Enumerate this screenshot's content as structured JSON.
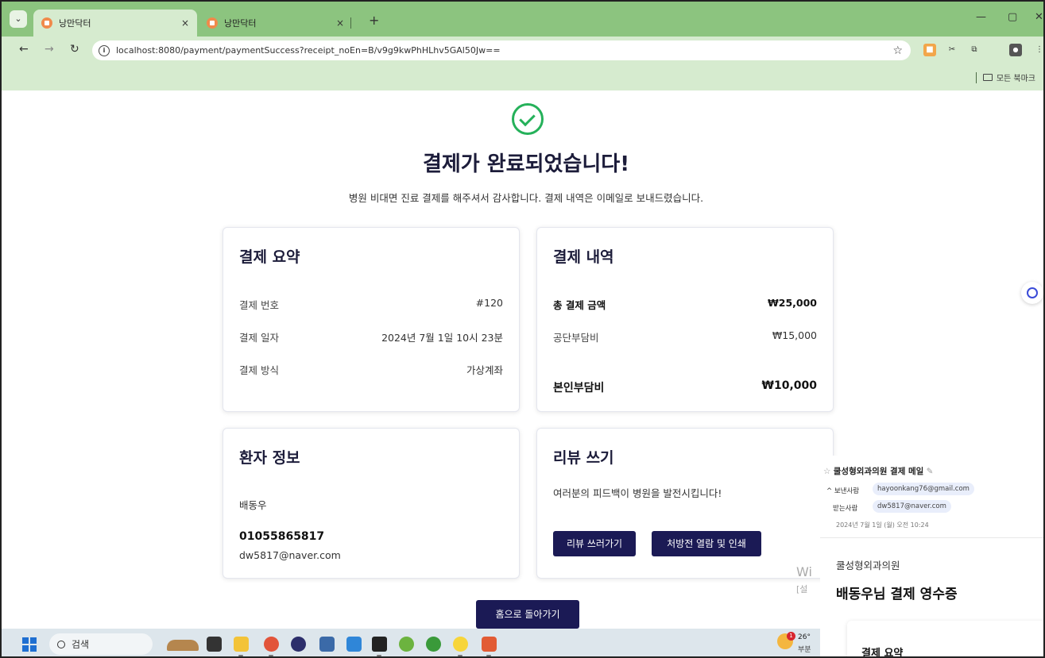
{
  "browser": {
    "tabs": [
      {
        "title": "낭만닥터",
        "close": "×"
      },
      {
        "title": "낭만닥터",
        "close": "×"
      }
    ],
    "new_tab": "+",
    "url": "localhost:8080/payment/paymentSuccess?receipt_noEn=B/v9g9kwPhHLhv5GAl50Jw==",
    "bookmarks_label": "모든 북마크"
  },
  "page": {
    "title": "결제가 완료되었습니다!",
    "subtitle": "병원 비대면 진료 결제를 해주셔서 감사합니다. 결제 내역은 이메일로 보내드렸습니다."
  },
  "summary": {
    "title": "결제 요약",
    "rows": [
      {
        "label": "결제 번호",
        "value": "#120"
      },
      {
        "label": "결제 일자",
        "value": "2024년 7월 1일 10시 23분"
      },
      {
        "label": "결제 방식",
        "value": "가상계좌"
      }
    ]
  },
  "details": {
    "title": "결제 내역",
    "total_label": "총 결제 금액",
    "total_value": "₩25,000",
    "public_label": "공단부담비",
    "public_value": "₩15,000",
    "self_label": "본인부담비",
    "self_value": "₩10,000"
  },
  "patient": {
    "title": "환자 정보",
    "name": "배동우",
    "phone": "01055865817",
    "email": "dw5817@naver.com"
  },
  "review": {
    "title": "리뷰 쓰기",
    "desc": "여러분의 피드백이 병원을 발전시킵니다!",
    "write_button": "리뷰 쓰러가기",
    "prescription_button": "처방전 열람 및 인쇄"
  },
  "home_button": "홈으로 돌아가기",
  "overlay_fragments": {
    "wi": "Wi",
    "setting": "[설"
  },
  "email": {
    "subject": "쿨성형외과의원 결제 메일",
    "sender_label": "보낸사람",
    "sender": "hayoonkang76@gmail.com",
    "recipient_label": "받는사람",
    "recipient": "dw5817@naver.com",
    "date": "2024년 7월 1일 (월) 오전 10:24",
    "clinic": "쿨성형외과의원",
    "heading": "배동우님 결제 영수증",
    "card_title": "결제 요약"
  },
  "taskbar": {
    "search_label": "검색",
    "weather_temp": "26°",
    "weather_desc": "부분",
    "notification_count": "1"
  },
  "colors": {
    "tabbar": "#8cc47f",
    "toolbar": "#d6ebcf",
    "accent_button": "#1b1a55",
    "success": "#25b15a"
  }
}
